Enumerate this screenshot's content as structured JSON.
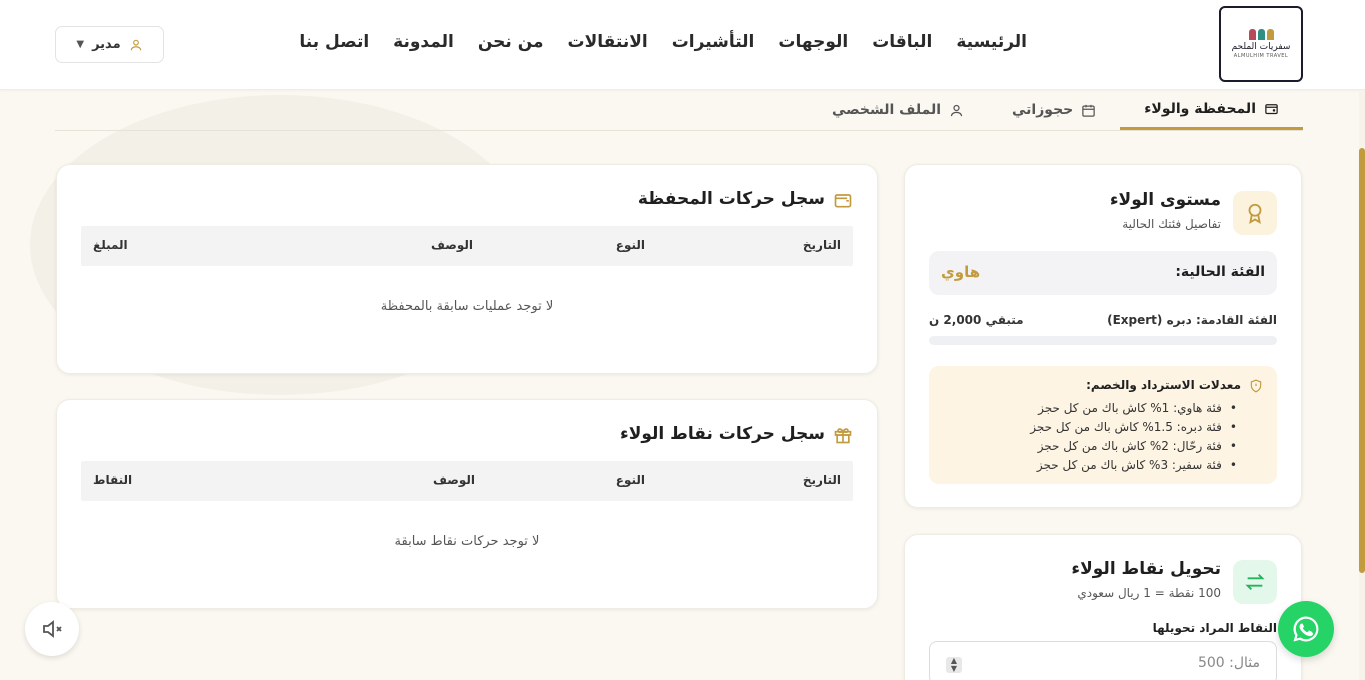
{
  "brand": {
    "name_ar": "سفريات الملحم",
    "name_en": "ALMULHIM TRAVEL",
    "colors": {
      "gold": "#c29b3f",
      "green": "#22b55c",
      "whatsapp": "#25d366"
    }
  },
  "nav": {
    "items": [
      "الرئيسية",
      "الباقات",
      "الوجهات",
      "التأشيرات",
      "الانتقالات",
      "من نحن",
      "المدونة",
      "اتصل بنا"
    ]
  },
  "user": {
    "label": "مدير"
  },
  "tabs": [
    {
      "label": "المحفظة والولاء",
      "icon": "wallet-icon",
      "active": true
    },
    {
      "label": "حجوزاتي",
      "icon": "calendar-icon",
      "active": false
    },
    {
      "label": "الملف الشخصي",
      "icon": "user-icon",
      "active": false
    }
  ],
  "wallet_log": {
    "title": "سجل حركات المحفظة",
    "columns": [
      "التاريخ",
      "النوع",
      "الوصف",
      "المبلغ"
    ],
    "empty": "لا توجد عمليات سابقة بالمحفظة"
  },
  "points_log": {
    "title": "سجل حركات نقاط الولاء",
    "columns": [
      "التاريخ",
      "النوع",
      "الوصف",
      "النقاط"
    ],
    "empty": "لا توجد حركات نقاط سابقة"
  },
  "loyalty": {
    "title": "مستوى الولاء",
    "subtitle": "تفاصيل فئتك الحالية",
    "current_label": "الفئة الحالية:",
    "current_value": "هاوي",
    "next_label": "الفئة القادمة: دبره (Expert)",
    "remaining": "متبقي 2,000 ن",
    "progress": 0,
    "rates_title": "معدلات الاسترداد والخصم:",
    "rates": [
      "فئة هاوي: 1% كاش باك من كل حجز",
      "فئة دبره: 1.5% كاش باك من كل حجز",
      "فئة رحّال: 2% كاش باك من كل حجز",
      "فئة سفير: 3% كاش باك من كل حجز"
    ]
  },
  "convert": {
    "title": "تحويل نقاط الولاء",
    "subtitle": "100 نقطة = 1 ريال سعودي",
    "field_label": "النقاط المراد تحويلها",
    "placeholder": "مثال: 500"
  }
}
